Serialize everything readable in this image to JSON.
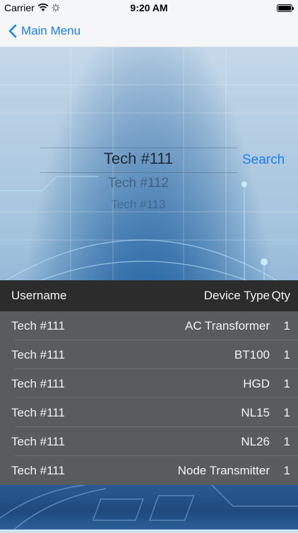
{
  "status_bar": {
    "carrier": "Carrier",
    "time": "9:20 AM"
  },
  "nav": {
    "back_label": "Main Menu"
  },
  "picker": {
    "selected": "Tech #111",
    "options_below": [
      "Tech #112",
      "Tech #113"
    ]
  },
  "search_label": "Search",
  "table": {
    "headers": {
      "username": "Username",
      "device_type": "Device Type",
      "qty": "Qty"
    },
    "rows": [
      {
        "username": "Tech #111",
        "device_type": "AC Transformer",
        "qty": "1"
      },
      {
        "username": "Tech #111",
        "device_type": "BT100",
        "qty": "1"
      },
      {
        "username": "Tech #111",
        "device_type": "HGD",
        "qty": "1"
      },
      {
        "username": "Tech #111",
        "device_type": "NL15",
        "qty": "1"
      },
      {
        "username": "Tech #111",
        "device_type": "NL26",
        "qty": "1"
      },
      {
        "username": "Tech #111",
        "device_type": "Node Transmitter",
        "qty": "1"
      }
    ]
  },
  "colors": {
    "accent": "#1a7ff5",
    "table_header_bg": "#2c2c2c",
    "table_row_bg": "#5a5b5d"
  }
}
